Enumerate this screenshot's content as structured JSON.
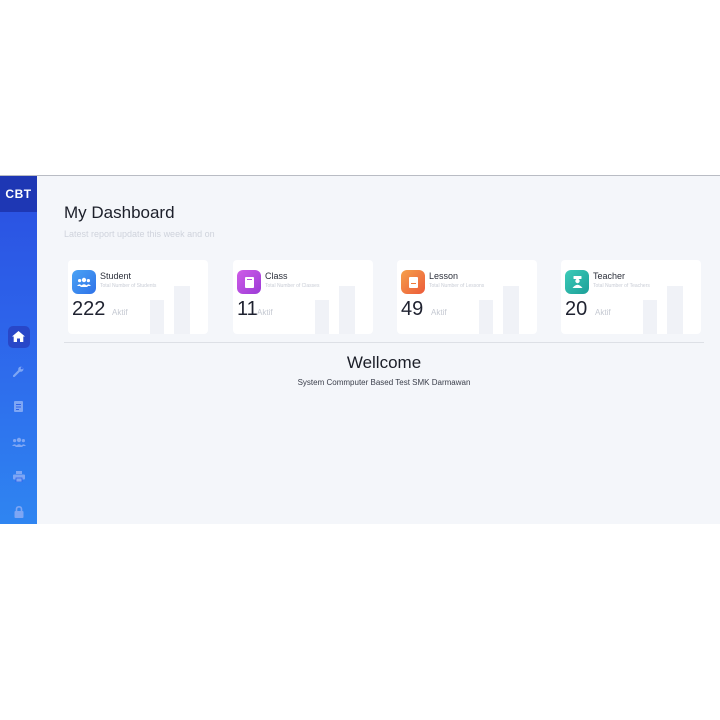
{
  "sidebar": {
    "brand": "CBT",
    "items": [
      {
        "icon": "home-icon",
        "active": true
      },
      {
        "icon": "wrench-icon",
        "active": false
      },
      {
        "icon": "document-icon",
        "active": false
      },
      {
        "icon": "users-icon",
        "active": false
      },
      {
        "icon": "printer-icon",
        "active": false
      },
      {
        "icon": "lock-icon",
        "active": false
      }
    ]
  },
  "header": {
    "title": "My Dashboard",
    "subtitle": "Latest report update this week and on"
  },
  "cards": [
    {
      "label": "Student",
      "description": "Total Number of Students",
      "value": "222",
      "status": "Aktif",
      "icon": "users-icon",
      "color": "#3f8ef0"
    },
    {
      "label": "Class",
      "description": "Total Number of Classes",
      "value": "11",
      "status": "Aktif",
      "icon": "book-icon",
      "color": "#b84fe0"
    },
    {
      "label": "Lesson",
      "description": "Total Number of Lessons",
      "value": "49",
      "status": "Aktif",
      "icon": "book-icon",
      "color": "#f07a3a"
    },
    {
      "label": "Teacher",
      "description": "Total Number of Teachers",
      "value": "20",
      "status": "Aktif",
      "icon": "teacher-icon",
      "color": "#27b5a8"
    }
  ],
  "welcome": {
    "title": "Wellcome",
    "subtitle": "System Commputer Based Test SMK Darmawan"
  }
}
